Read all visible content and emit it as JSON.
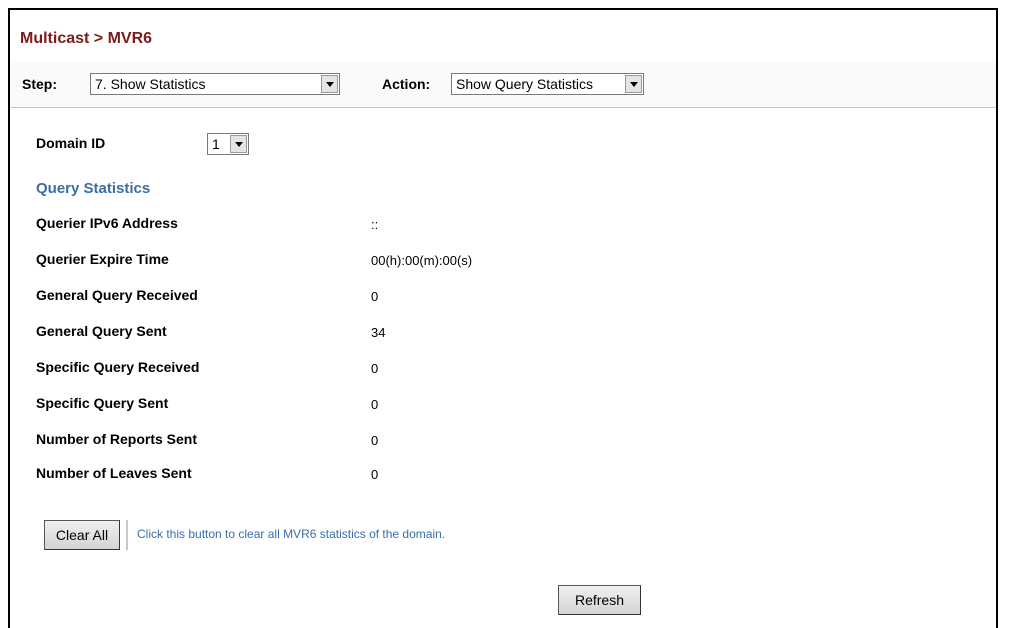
{
  "header": {
    "title": "Multicast > MVR6"
  },
  "toolbar": {
    "step_label": "Step:",
    "step_value": "7. Show Statistics",
    "action_label": "Action:",
    "action_value": "Show Query Statistics"
  },
  "domain": {
    "label": "Domain ID",
    "value": "1"
  },
  "section": {
    "title": "Query Statistics"
  },
  "stats": [
    {
      "label": "Querier IPv6 Address",
      "value": "::"
    },
    {
      "label": "Querier Expire Time",
      "value": "00(h):00(m):00(s)"
    },
    {
      "label": "General Query Received",
      "value": "0"
    },
    {
      "label": "General Query Sent",
      "value": "34"
    },
    {
      "label": "Specific Query Received",
      "value": "0"
    },
    {
      "label": "Specific Query Sent",
      "value": "0"
    },
    {
      "label": "Number of Reports Sent",
      "value": "0"
    },
    {
      "label": "Number of Leaves Sent",
      "value": "0"
    }
  ],
  "actions": {
    "clear_label": "Clear All",
    "clear_hint": "Click this button to clear all MVR6 statistics of the domain.",
    "refresh_label": "Refresh"
  },
  "colors": {
    "title": "#7b1c1c",
    "section": "#3a6ea5",
    "hint": "#3a6ea5"
  }
}
